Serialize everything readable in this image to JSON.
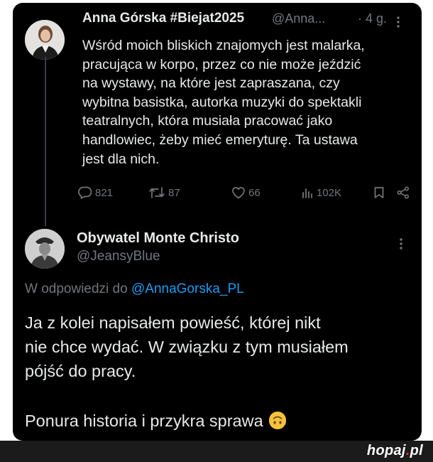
{
  "tweet": {
    "author_name": "Anna Górska #Biejat2025",
    "handle": "@Anna...",
    "time": "· 4 g.",
    "lines": [
      "Wśród moich bliskich znajomych jest malarka,",
      "pracująca w korpo, przez co nie może jeździć",
      "na wystawy, na które jest zapraszana, czy",
      "wybitna basistka, autorka muzyki do spektakli",
      "teatralnych, która musiała pracować jako",
      "handlowiec, żeby mieć emeryturę. Ta ustawa",
      "jest dla nich."
    ],
    "stats": {
      "replies": "821",
      "retweets": "87",
      "likes": "66",
      "views": "102K"
    }
  },
  "reply": {
    "author_name": "Obywatel Monte Christo",
    "handle": "@JeansyBlue",
    "replying_prefix": "W odpowiedzi do",
    "replying_to": "@AnnaGorska_PL",
    "lines": [
      "Ja z kolei napisałem powieść, której nikt",
      "nie chce wydać. W związku z tym musiałem",
      "pójść do pracy."
    ],
    "closing": "Ponura historia i przykra sprawa"
  },
  "footer": {
    "brand": "hopaj",
    "brand_dot": ".",
    "brand_tld": "pl"
  },
  "colors": {
    "background": "#000000",
    "text": "#e7e9ea",
    "muted": "#71767b",
    "link": "#1d9bf0"
  }
}
